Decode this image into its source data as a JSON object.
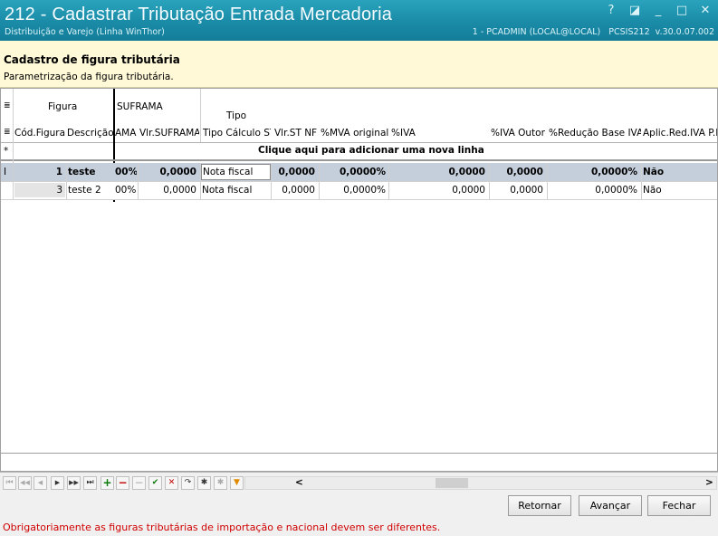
{
  "window": {
    "title": "212 - Cadastrar Tributação Entrada Mercadoria",
    "subtitle": "Distribuição e Varejo (Linha WinThor)",
    "sysinfo": "1 - PCADMIN (LOCAL@LOCAL)   PCSIS212  v.30.0.07.002",
    "controls": {
      "help": "?",
      "restore": "◪",
      "minimize": "_",
      "maximize": "□",
      "close": "✕"
    }
  },
  "header": {
    "title": "Cadastro de figura tributária",
    "description": "Parametrização da figura tributária."
  },
  "grid": {
    "groups": {
      "figura": "Figura",
      "suframa": "SUFRAMA",
      "tipo": "Tipo"
    },
    "columns": {
      "cod": "Cód.Figura",
      "desc": "Descrição",
      "ama": "AMA",
      "vlr_suframa": "Vlr.SUFRAMA",
      "tipo_calc": "Tipo Cálculo ST",
      "vlr_st_nf": "Vlr.ST NF",
      "mva": "%MVA  original",
      "iva": "%IVA",
      "iva_outor": "%IVA Outor",
      "red_base": "%Redução Base IVA",
      "aplic": "Aplic.Red.IVA P.I"
    },
    "new_row": "Clique aqui para adicionar uma nova linha",
    "rows": [
      {
        "cod": "1",
        "desc": "teste",
        "ama": "00%",
        "vlr_suframa": "0,0000",
        "tipo_calc": "Nota fiscal",
        "vlr_st_nf": "0,0000",
        "mva": "0,0000%",
        "iva": "0,0000",
        "iva_outor": "0,0000",
        "red_base": "0,0000%",
        "aplic": "Não"
      },
      {
        "cod": "3",
        "desc": "teste 2",
        "ama": "00%",
        "vlr_suframa": "0,0000",
        "tipo_calc": "Nota fiscal",
        "vlr_st_nf": "0,0000",
        "mva": "0,0000%",
        "iva": "0,0000",
        "iva_outor": "0,0000",
        "red_base": "0,0000%",
        "aplic": "Não"
      }
    ],
    "row_indicator_new": "*",
    "row_indicator_current": "I"
  },
  "navigator": {
    "first": "⏮",
    "prev_page": "◀◀",
    "prev": "◀",
    "next": "▶",
    "next_page": "▶▶",
    "last": "⏭",
    "insert": "+",
    "delete": "−",
    "edit": "−",
    "post": "✔",
    "cancel": "✕",
    "refresh": "↷",
    "scroll_left": "<",
    "scroll_right": ">"
  },
  "buttons": {
    "back": "Retornar",
    "next": "Avançar",
    "close": "Fechar"
  },
  "status": "Obrigatoriamente as figuras tributárias de importação e nacional devem ser diferentes.",
  "colors": {
    "titlebar": "#1a8ba7",
    "header_bg": "#fff9d8",
    "selected_row": "#c5cfdc",
    "status_text": "#d00000"
  }
}
